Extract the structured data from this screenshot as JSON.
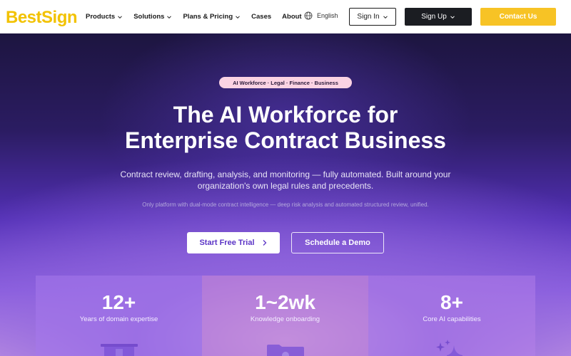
{
  "nav": {
    "logo": "BestSign",
    "menu": [
      {
        "label": "Products",
        "has_dropdown": true
      },
      {
        "label": "Solutions",
        "has_dropdown": true
      },
      {
        "label": "Plans & Pricing",
        "has_dropdown": true
      },
      {
        "label": "Cases",
        "has_dropdown": false
      },
      {
        "label": "About",
        "has_dropdown": false
      }
    ],
    "language": "English",
    "sign_in": "Sign In",
    "sign_up": "Sign Up",
    "contact": "Contact Us"
  },
  "hero": {
    "badge": "AI Workforce · Legal · Finance · Business",
    "title_line1": "The AI Workforce for",
    "title_line2": "Enterprise Contract Business",
    "subtitle": "Contract review, drafting, analysis, and monitoring — fully automated. Built around your organization's own legal rules and precedents.",
    "note": "Only platform with dual-mode contract intelligence — deep risk analysis and automated structured review, unified.",
    "primary_cta": "Start Free Trial",
    "secondary_cta": "Schedule a Demo"
  },
  "stats": [
    {
      "value": "12+",
      "label": "Years of domain expertise",
      "icon": "building-icon"
    },
    {
      "value": "1~2wk",
      "label": "Knowledge onboarding",
      "icon": "folder-icon"
    },
    {
      "value": "8+",
      "label": "Core AI capabilities",
      "icon": "sparkle-icon"
    }
  ],
  "colors": {
    "brand_yellow": "#f7c325",
    "dark_button": "#1b1d22",
    "hero_dark": "#1d1540",
    "hero_purple": "#5330b6",
    "cta_text": "#5b34c6",
    "badge_bg": "#fbd3e3"
  }
}
